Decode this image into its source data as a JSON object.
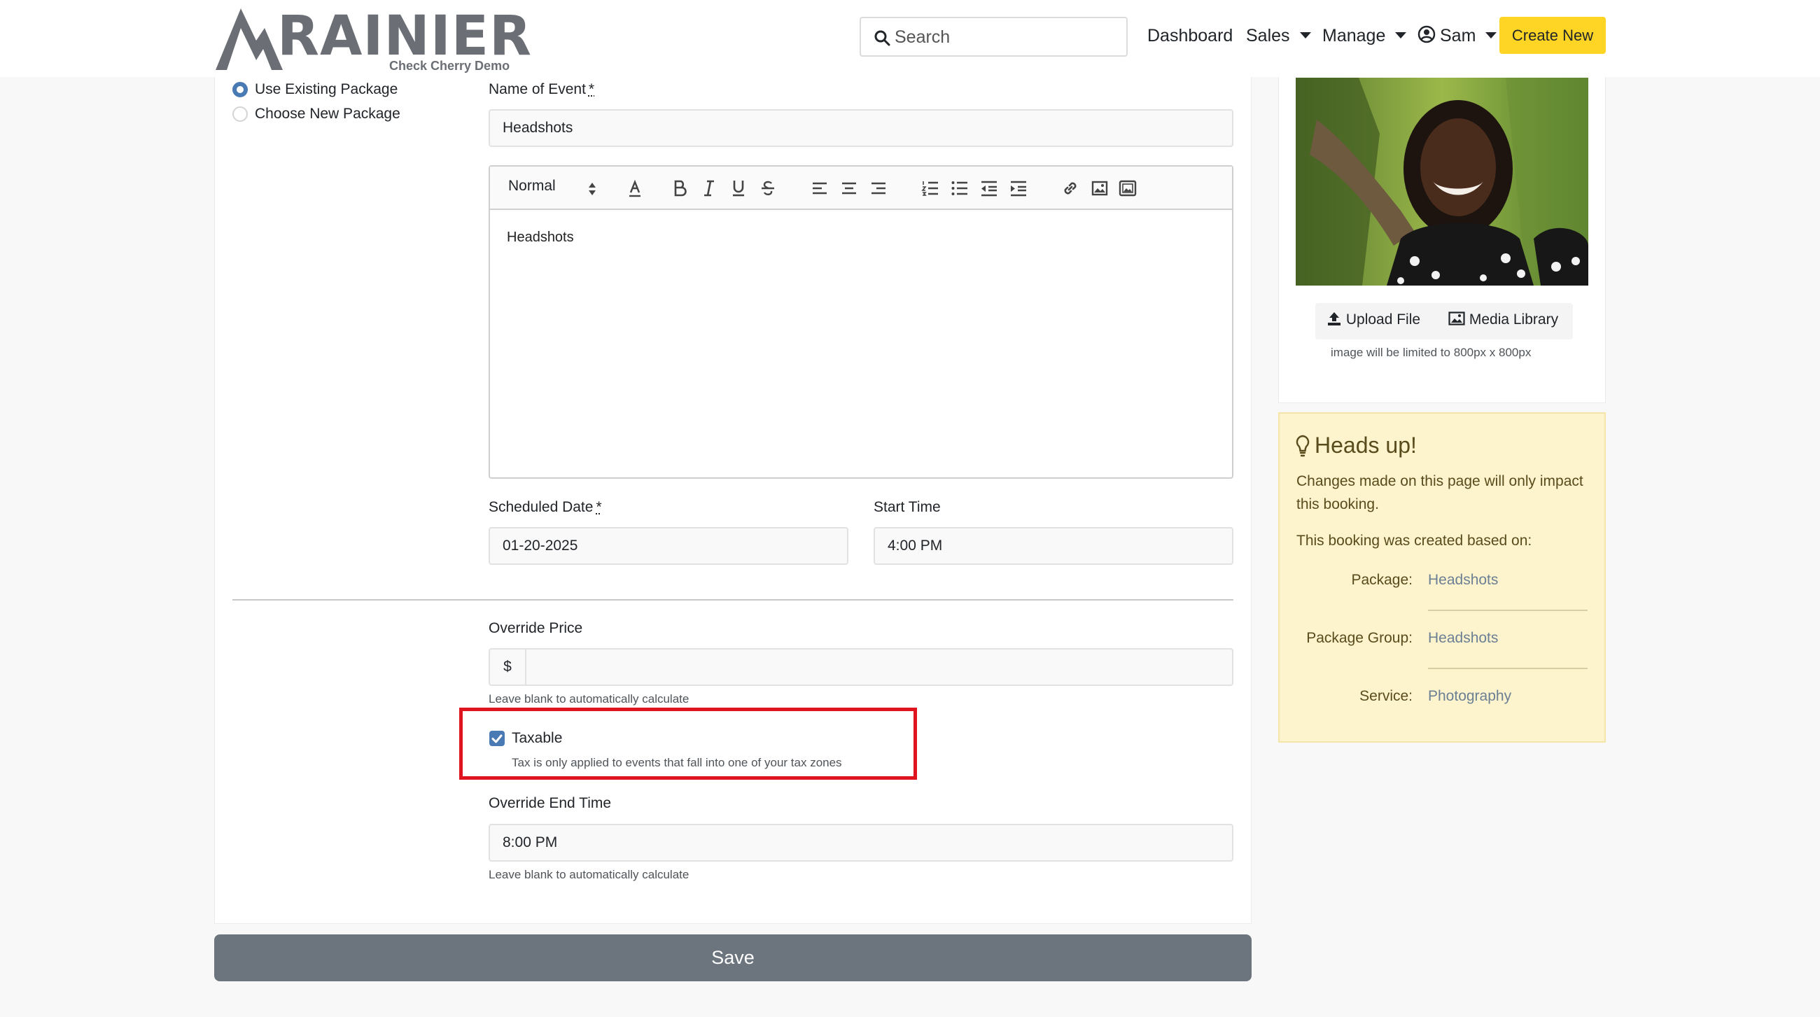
{
  "header": {
    "logo_text": "RAINIER",
    "logo_subtext": "Check Cherry Demo",
    "search_placeholder": "Search",
    "nav": {
      "dashboard": "Dashboard",
      "sales": "Sales",
      "manage": "Manage",
      "user": "Sam"
    },
    "create_new": "Create New"
  },
  "package_choice": {
    "use_existing": "Use Existing Package",
    "choose_new": "Choose New Package",
    "selected": "use_existing"
  },
  "form": {
    "name_label": "Name of Event",
    "required_mark": "*",
    "name_value": "Headshots",
    "editor": {
      "format_select": "Normal",
      "content": "Headshots"
    },
    "date_label": "Scheduled Date",
    "date_value": "01-20-2025",
    "start_label": "Start Time",
    "start_value": "4:00 PM",
    "override_price_label": "Override Price",
    "currency_symbol": "$",
    "override_price_value": "",
    "override_price_help": "Leave blank to automatically calculate",
    "taxable_label": "Taxable",
    "taxable_checked": true,
    "taxable_help": "Tax is only applied to events that fall into one of your tax zones",
    "override_end_label": "Override End Time",
    "override_end_value": "8:00 PM",
    "override_end_help": "Leave blank to automatically calculate"
  },
  "save_label": "Save",
  "media": {
    "upload_label": "Upload File",
    "library_label": "Media Library",
    "limit_note": "image will be limited to 800px x 800px"
  },
  "headsup": {
    "title": "Heads up!",
    "message": "Changes made on this page will only impact this booking.",
    "based_on": "This booking was created based on:",
    "rows": [
      {
        "label": "Package:",
        "value": "Headshots"
      },
      {
        "label": "Package Group:",
        "value": "Headshots"
      },
      {
        "label": "Service:",
        "value": "Photography"
      }
    ]
  },
  "colors": {
    "accent_yellow": "#ffd525",
    "highlight_red": "#e0141e",
    "save_gray": "#6c757d",
    "checkbox_blue": "#4a7ab4"
  }
}
